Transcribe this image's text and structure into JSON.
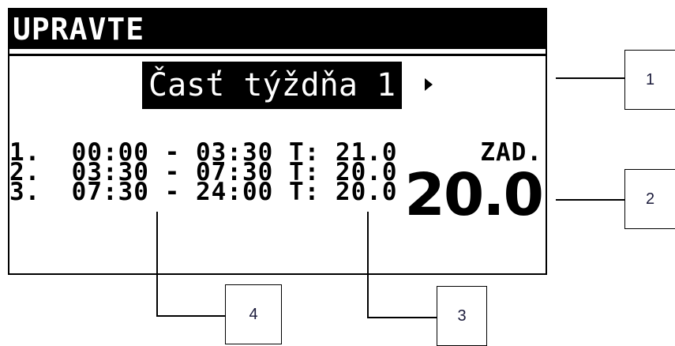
{
  "screen": {
    "title": "UPRAVTE",
    "part_label": "Časť týždňa 1",
    "schedule": [
      {
        "line": "1.  00:00 - 03:30 T: 21.0"
      },
      {
        "line": "2.  03:30 - 07:30 T: 20.0"
      },
      {
        "line": "3.  07:30 - 24:00 T: 20.0"
      }
    ],
    "setpoint_label": "ZAD.",
    "setpoint_value": "20.0"
  },
  "callouts": {
    "one": "1",
    "two": "2",
    "three": "3",
    "four": "4"
  },
  "icons": {
    "next": "arrow-right-icon"
  },
  "colors": {
    "display_bg": "#ffffff",
    "display_fg": "#000000",
    "callout_text": "#1a1a3a"
  }
}
